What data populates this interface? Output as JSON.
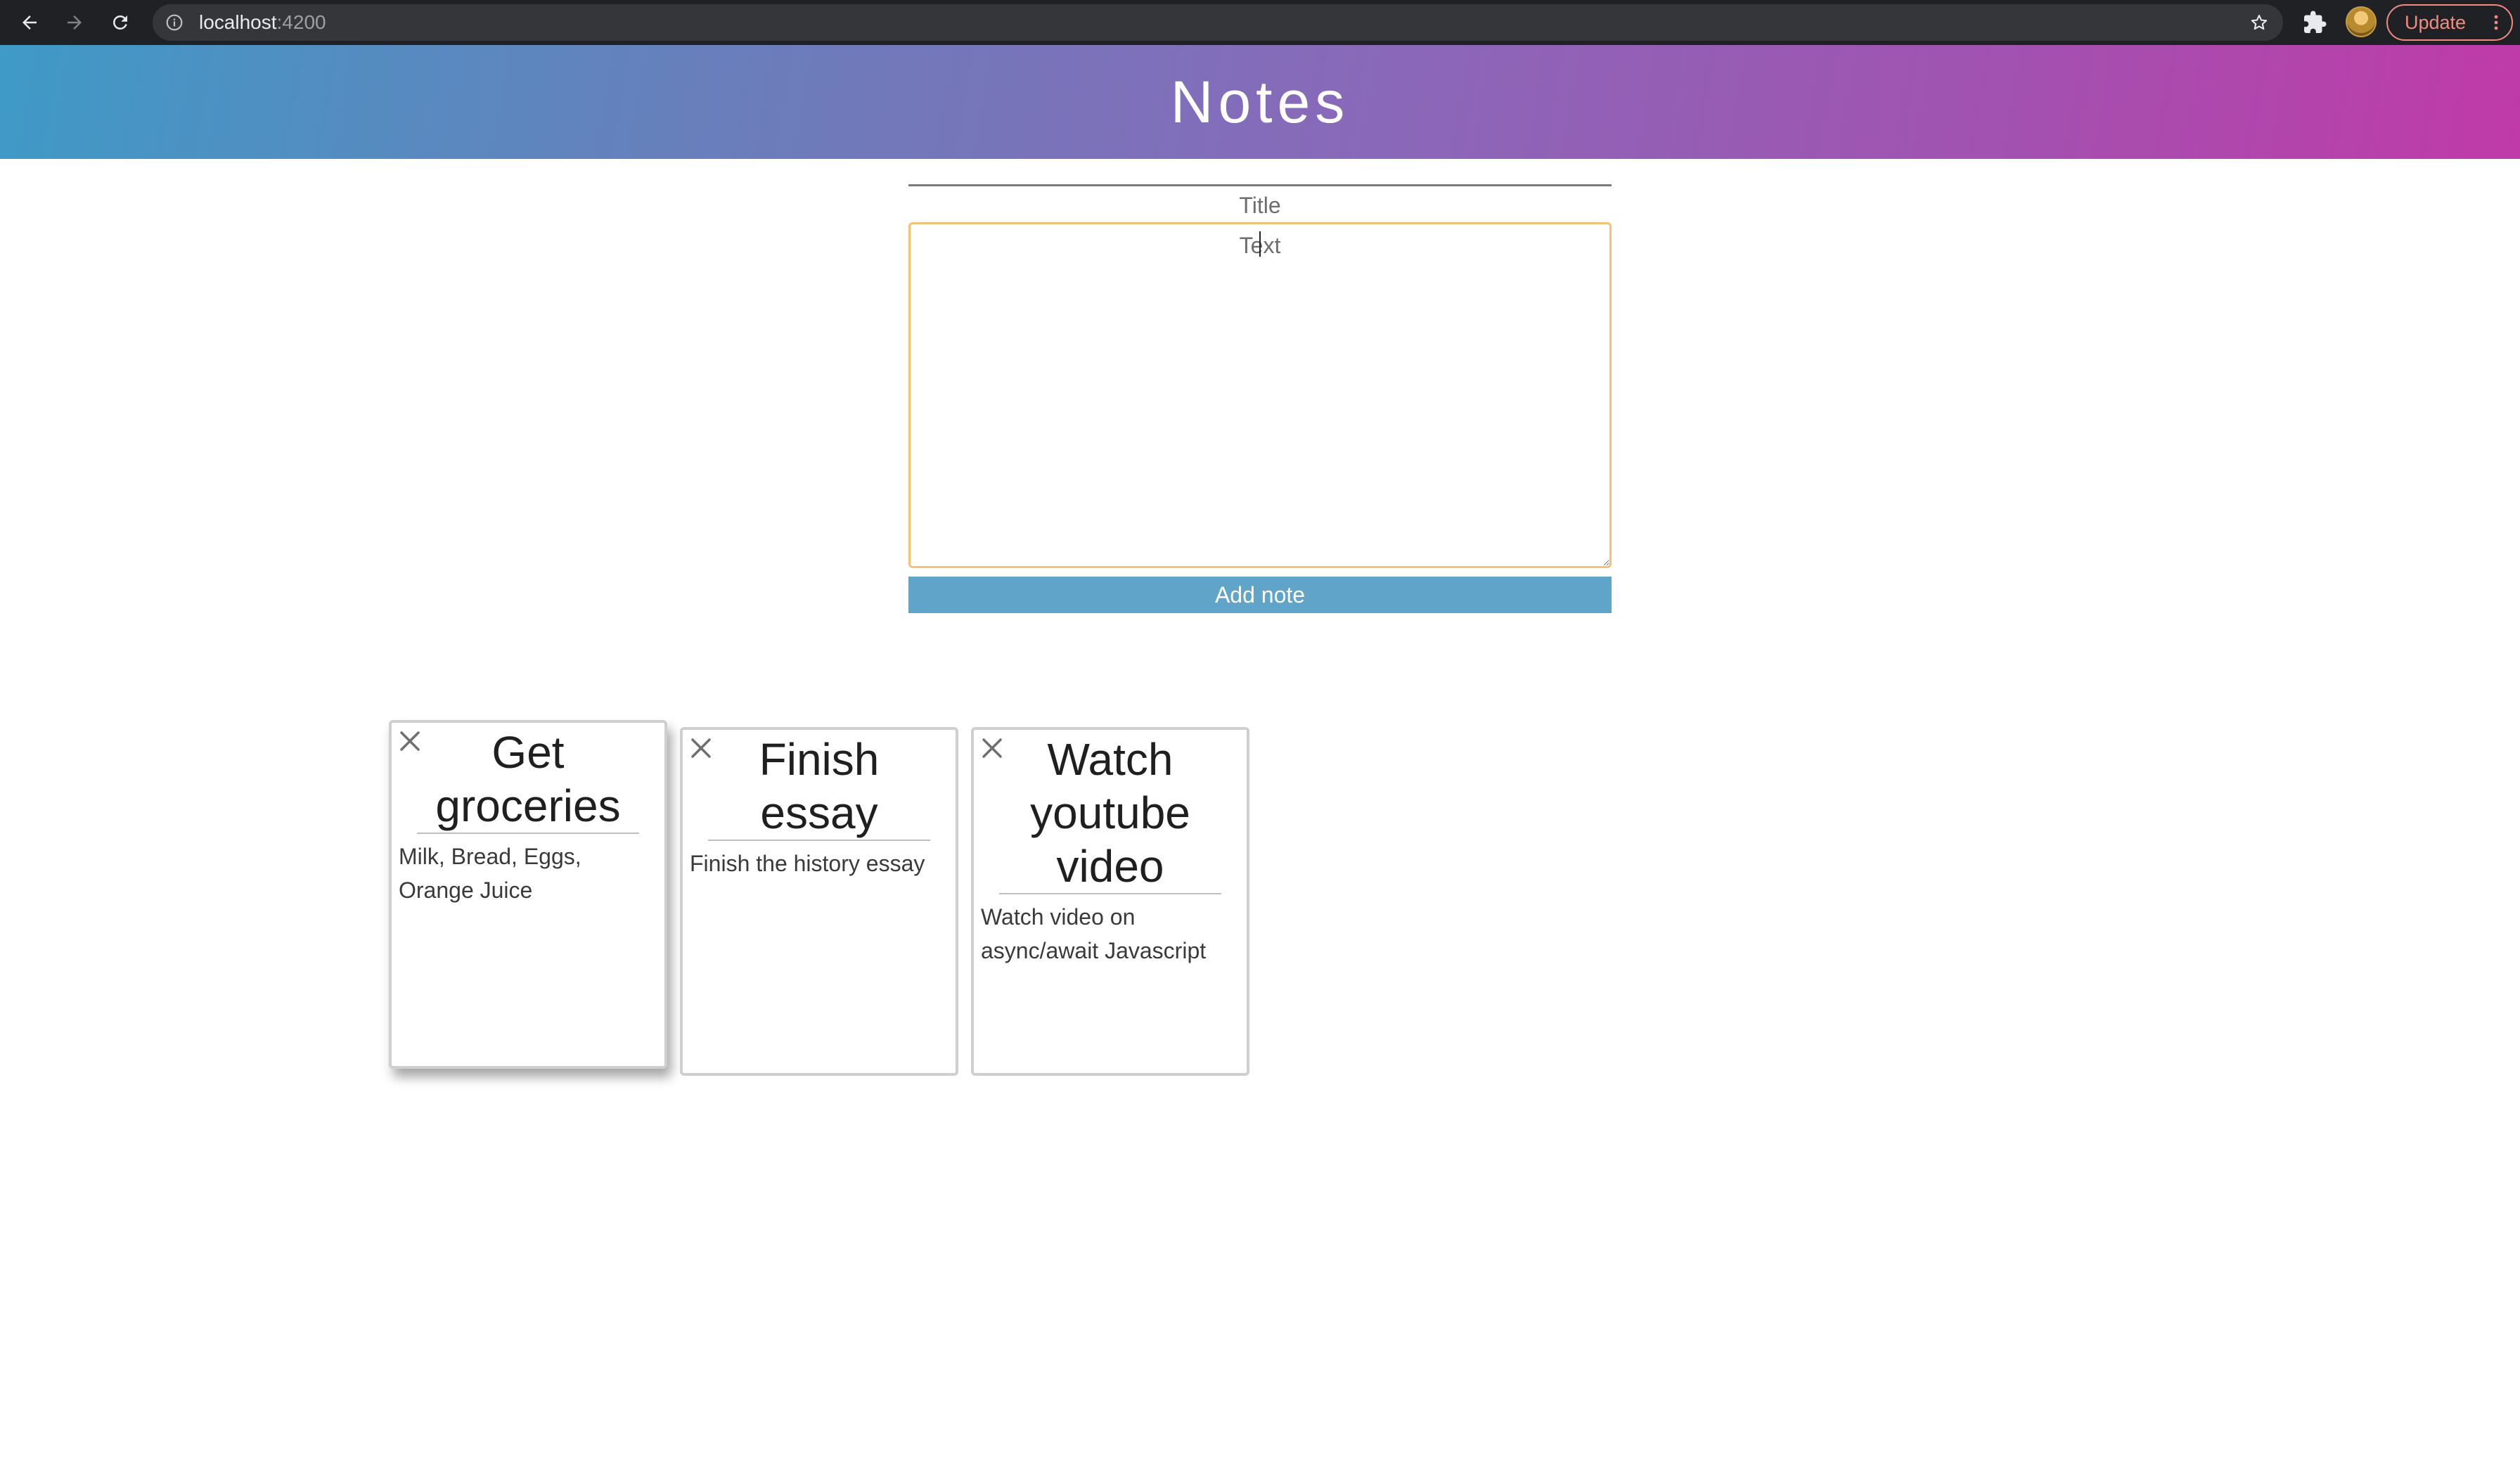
{
  "browser": {
    "url_host": "localhost",
    "url_port": ":4200",
    "update_label": "Update"
  },
  "app": {
    "title": "Notes"
  },
  "form": {
    "title_placeholder": "Title",
    "text_placeholder": "Text",
    "add_label": "Add note"
  },
  "notes": [
    {
      "title": "Get groceries",
      "body": "Milk, Bread, Eggs, Orange Juice"
    },
    {
      "title": "Finish essay",
      "body": "Finish the history essay"
    },
    {
      "title": "Watch youtube video",
      "body": "Watch video on async/await Javascript"
    }
  ],
  "colors": {
    "header_gradient_start": "#3f9ac6",
    "header_gradient_end": "#c03aa9",
    "button": "#60a5c9",
    "textarea_focus_border": "#f3c277"
  },
  "icons": {
    "back": "back-arrow-icon",
    "forward": "forward-arrow-icon",
    "reload": "reload-icon",
    "info": "info-icon",
    "bookmark": "star-icon",
    "extensions": "puzzle-icon",
    "menu": "kebab-menu-icon",
    "note_close": "close-icon"
  }
}
